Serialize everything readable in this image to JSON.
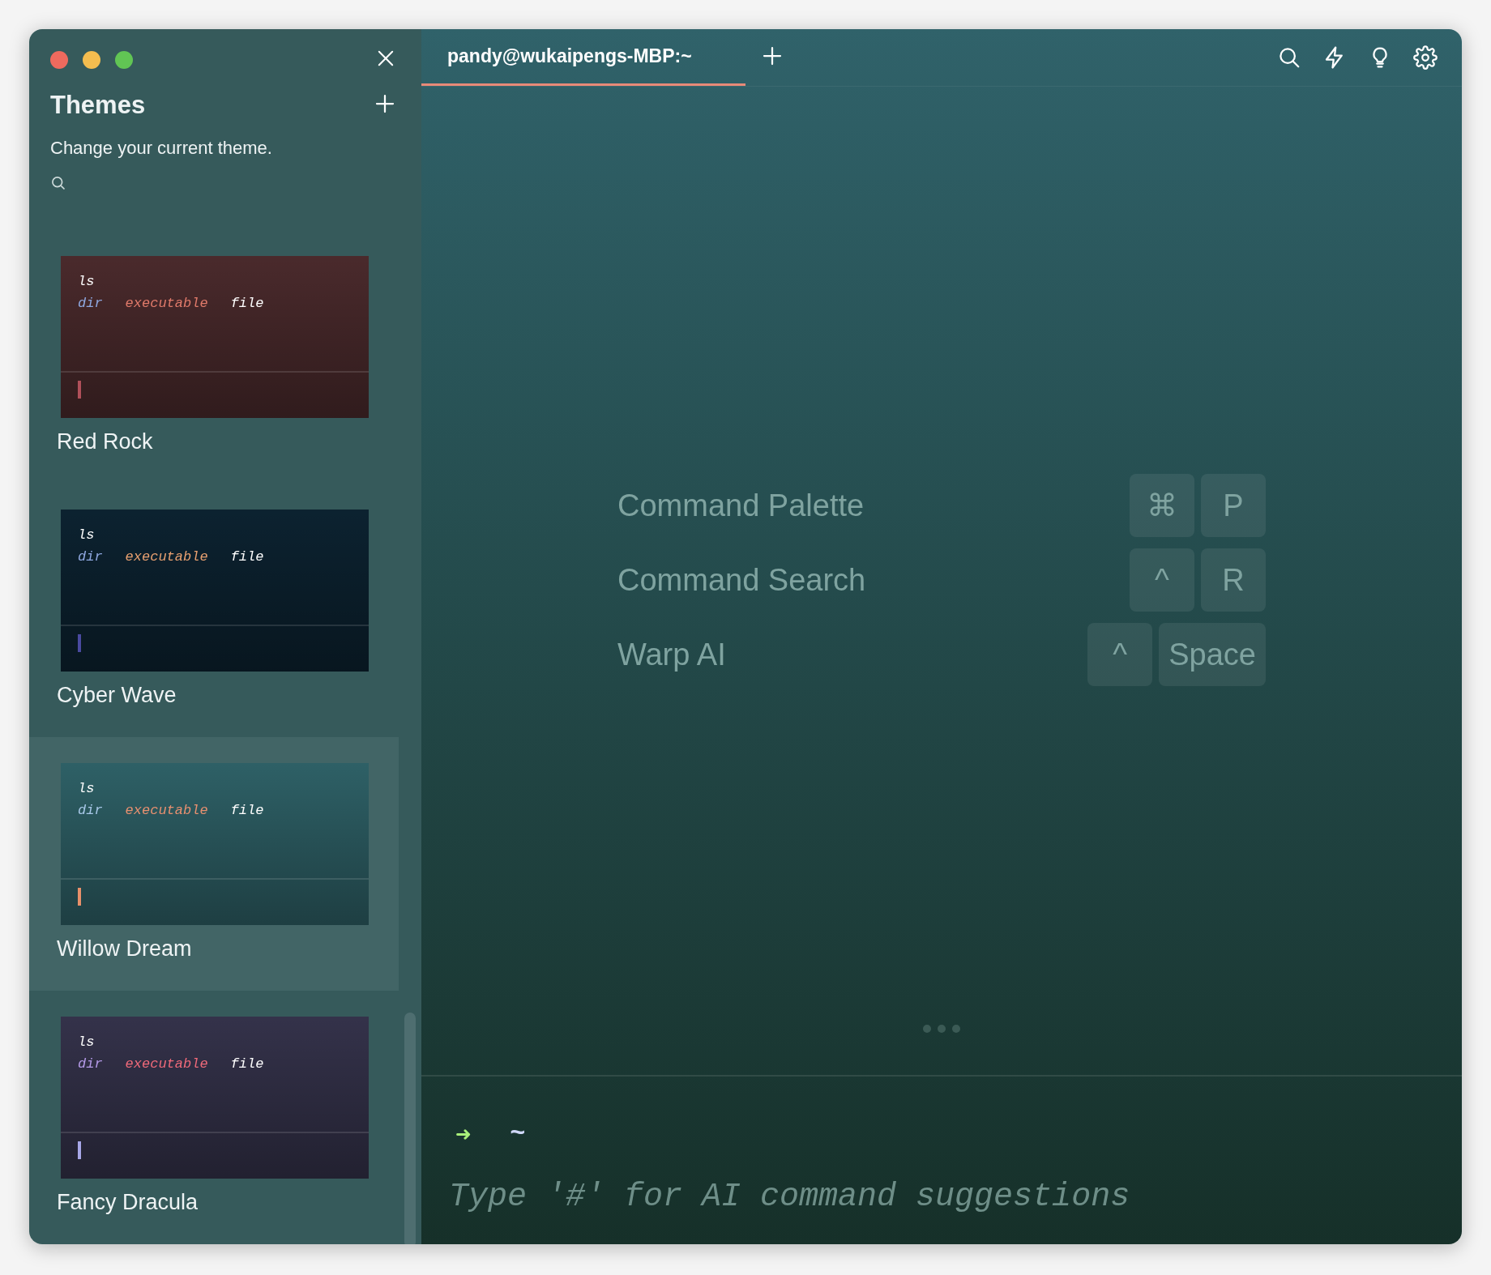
{
  "sidebar": {
    "title": "Themes",
    "subtitle": "Change your current theme.",
    "themes": [
      {
        "name": "Red Rock",
        "selected": false,
        "color": "#4a2a2c",
        "preview": {
          "command": "ls",
          "files": [
            {
              "text": "dir",
              "color": "#8fa8e0"
            },
            {
              "text": "executable",
              "color": "#e07a6a"
            },
            {
              "text": "file",
              "color": "#ffffff"
            }
          ],
          "cursor": {
            "color": "#b0505a"
          }
        }
      },
      {
        "name": "Cyber Wave",
        "selected": false,
        "color": "#0c2230",
        "preview": {
          "command": "ls",
          "files": [
            {
              "text": "dir",
              "color": "#8fa8e0"
            },
            {
              "text": "executable",
              "color": "#e8a070"
            },
            {
              "text": "file",
              "color": "#ffffff"
            }
          ],
          "cursor": {
            "color": "#4a4aa0"
          }
        }
      },
      {
        "name": "Willow Dream",
        "selected": true,
        "color": "#2e6066",
        "preview": {
          "command": "ls",
          "files": [
            {
              "text": "dir",
              "color": "#a8c8e8"
            },
            {
              "text": "executable",
              "color": "#e89070"
            },
            {
              "text": "file",
              "color": "#ffffff"
            }
          ],
          "cursor": {
            "color": "#e8906a"
          }
        }
      },
      {
        "name": "Fancy Dracula",
        "selected": false,
        "color": "#34324a",
        "preview": {
          "command": "ls",
          "files": [
            {
              "text": "dir",
              "color": "#b49ae8"
            },
            {
              "text": "executable",
              "color": "#f06a7a"
            },
            {
              "text": "file",
              "color": "#ffffff"
            }
          ],
          "cursor": {
            "color": "#a8a8e8"
          }
        }
      }
    ]
  },
  "tabs": [
    {
      "label": "pandy@wukaipengs-MBP:~",
      "selected": true
    }
  ],
  "shortcuts": [
    {
      "label": "Command Palette",
      "keys": [
        "⌘",
        "P"
      ]
    },
    {
      "label": "Command Search",
      "keys": [
        "^",
        "R"
      ]
    },
    {
      "label": "Warp AI",
      "keys": [
        "^",
        "Space"
      ]
    }
  ],
  "prompt": {
    "arrow": "➜",
    "path": "~",
    "placeholder": "Type '#' for AI command suggestions"
  }
}
